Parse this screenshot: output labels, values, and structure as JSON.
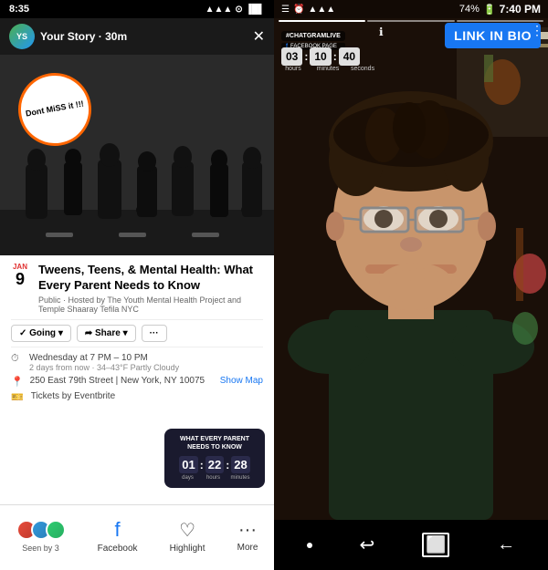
{
  "left": {
    "statusBar": {
      "time": "8:35",
      "icons": "▲ ◀ ■ ▐▐"
    },
    "storyHeader": {
      "title": "Your Story · 30m",
      "closeLabel": "✕"
    },
    "storySticker": {
      "text": "Dont MiSS it !!!"
    },
    "event": {
      "month": "JAN",
      "day": "9",
      "title": "Tweens, Teens, & Mental Health: What Every Parent Needs to Know",
      "subtitle": "Public · Hosted by The Youth Mental Health Project and Temple Shaaray Tefila NYC",
      "goingLabel": "✓ Going ▾",
      "shareLabel": "➦ Share ▾",
      "moreLabel": "···",
      "detail1": "Wednesday at 7 PM – 10 PM",
      "detail1sub": "2 days from now · 34–43°F Partly Cloudy",
      "detail2": "250 East 79th Street | New York, NY 10075",
      "showMap": "Show Map",
      "tickets": "Tickets by Eventbrite"
    },
    "countdown": {
      "title": "WHAT EVERY PARENT NEEDS TO KNOW",
      "d1": "01",
      "d2": "22",
      "d3": "28",
      "label1": "days",
      "label2": "hours",
      "label3": "minutes"
    },
    "bottomBar": {
      "seenBy": "Seen by 3",
      "facebookLabel": "Facebook",
      "highlightLabel": "Highlight",
      "moreLabel": "More"
    }
  },
  "right": {
    "statusBar": {
      "leftIcons": "🔵 ▲ ▲",
      "time": "7:40 PM",
      "batteryPercent": "74%"
    },
    "hashtagLabel": "#CHATGRAMLIVE",
    "facebookPageLabel": "FACEBOOK PAGE",
    "linkInBio": "LINK IN BIO",
    "timer": {
      "h1": "03",
      "h2": "10",
      "h3": "40",
      "label1": "hours",
      "label2": "minutes",
      "label3": "seconds"
    },
    "bottomNav": {
      "dot": "●",
      "reply": "↩",
      "share": "⬜",
      "back": "←"
    }
  }
}
